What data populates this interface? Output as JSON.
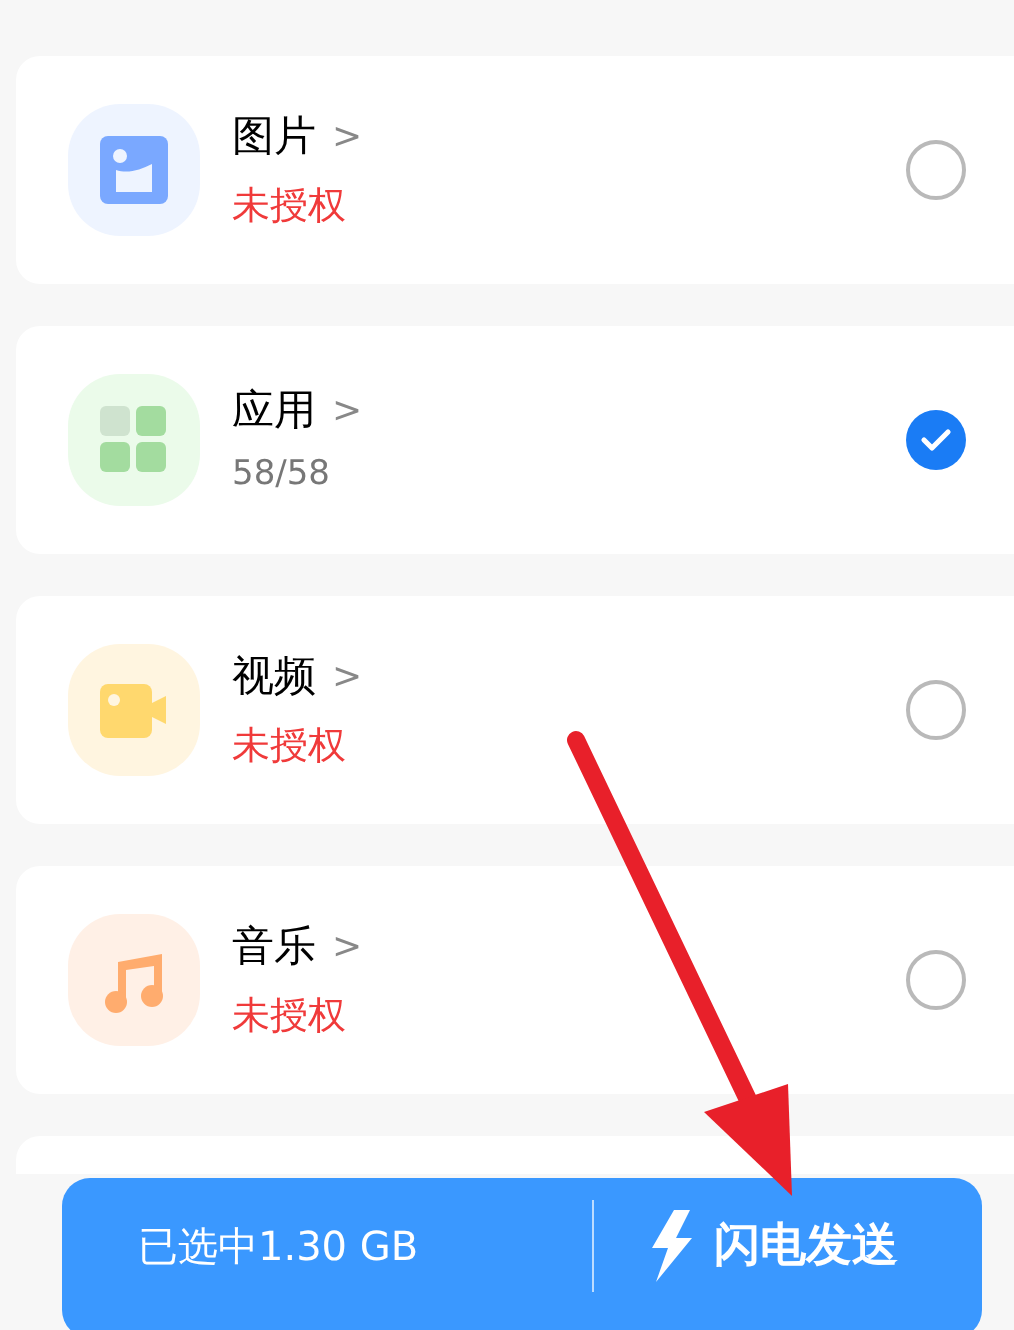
{
  "categories": [
    {
      "kind": "image",
      "title": "图片",
      "chevron": ">",
      "subtitle": {
        "kind": "warning",
        "text": "未授权"
      },
      "checked": false
    },
    {
      "kind": "apps",
      "title": "应用",
      "chevron": ">",
      "subtitle": {
        "kind": "count",
        "text": "58/58"
      },
      "checked": true
    },
    {
      "kind": "video",
      "title": "视频",
      "chevron": ">",
      "subtitle": {
        "kind": "warning",
        "text": "未授权"
      },
      "checked": false
    },
    {
      "kind": "music",
      "title": "音乐",
      "chevron": ">",
      "subtitle": {
        "kind": "warning",
        "text": "未授权"
      },
      "checked": false
    }
  ],
  "bottom_bar": {
    "selected_size": "已选中1.30 GB",
    "send_label": "闪电发送"
  }
}
